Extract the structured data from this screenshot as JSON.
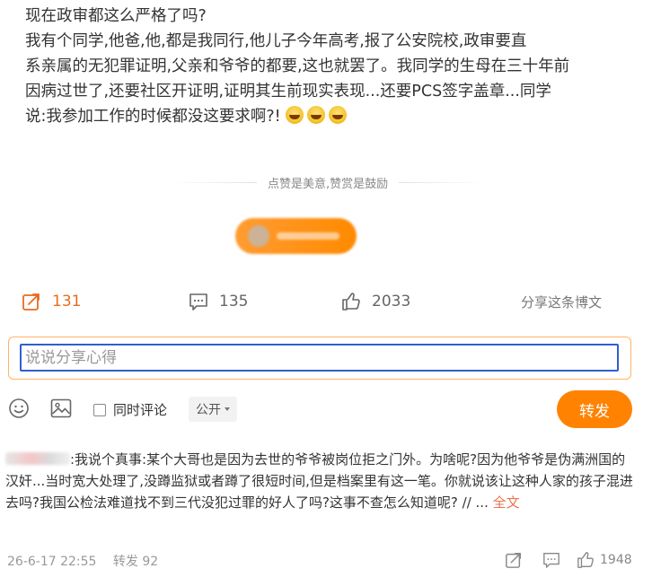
{
  "post": {
    "title": "现在政审都这么严格了吗?",
    "line1": "我有个同学,他爸,他,都是我同行,他儿子今年高考,报了公安院校,政审要直",
    "line2": "系亲属的无犯罪证明,父亲和爷爷的都要,这也就罢了。我同学的生母在三十年前",
    "line3": "因病过世了,还要社区开证明,证明其生前现实表现...还要PCS签字盖章...同学",
    "line4": "说:我参加工作的时候都没这要求啊?!",
    "emojis": [
      "laugh-cry-emoji",
      "laugh-cry-emoji",
      "laugh-cry-emoji"
    ]
  },
  "slogan": "点赞是美意,赞赏是鼓励",
  "actions": {
    "share_count": "131",
    "comment_count": "135",
    "like_count": "2033",
    "share_post_label": "分享这条博文"
  },
  "editor": {
    "placeholder": "说说分享心得",
    "sync_label": "同时评论",
    "visibility": "公开",
    "forward_button": "转发"
  },
  "comment": {
    "text": ":我说个真事:某个大哥也是因为去世的爷爷被岗位拒之门外。为啥呢?因为他爷爷是伪满洲国的汉奸...当时宽大处理了,没蹲监狱或者蹲了很短时间,但是档案里有这一笔。你就说该让这种人家的孩子混进去吗?我国公检法难道找不到三代没犯过罪的好人了吗?这事不查怎么知道呢? // ...",
    "fulltext_label": "全文",
    "time": "26-6-17 22:55",
    "reposts": "转发 92",
    "likes": "1948"
  },
  "colors": {
    "accent": "#ff8200",
    "share_active": "#e86b1f",
    "editor_focus": "#2f5fd0",
    "link": "#eb7350"
  }
}
